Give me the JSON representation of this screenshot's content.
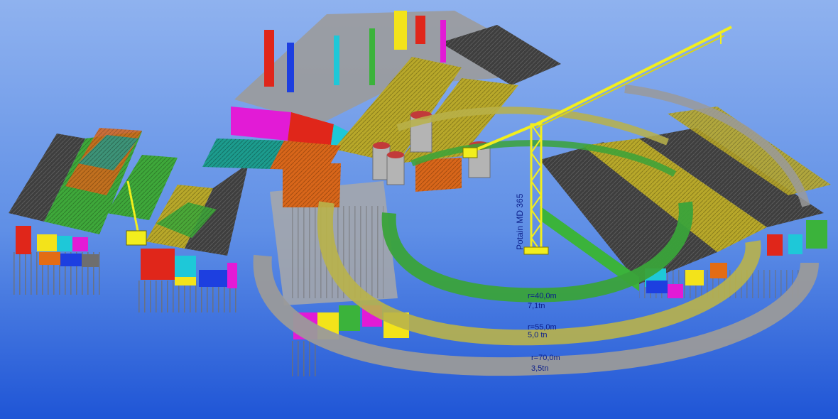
{
  "colors": {
    "sky_top": "#7ea6ec",
    "sky_bottom": "#1a4fcf",
    "slab_grey": "#8e8e8e",
    "slab_dark": "#555555",
    "roof_dark": "#3d3d3d",
    "ring_outer": "#9a9a9a",
    "ring_mid": "#b9b24a",
    "ring_inner": "#3aa33a",
    "crane_yellow": "#f2ee1d",
    "magenta": "#e21bd6",
    "red": "#e0261a",
    "orange": "#e36c14",
    "green": "#3bb33b",
    "cyan": "#1ec8d8",
    "blue": "#1d3fe0",
    "yellow": "#f3e31a",
    "olive": "#b6a82c",
    "teal": "#1a9c9c",
    "label_blue": "#0b1e8a"
  },
  "crane": {
    "model_label": "Potain MD 365"
  },
  "radius_labels": [
    {
      "radius": "r=40,0m",
      "load": "7,1tn"
    },
    {
      "radius": "r=55,0m",
      "load": "5,0 tn"
    },
    {
      "radius": "r=70,0m",
      "load": "3,5tn"
    }
  ]
}
